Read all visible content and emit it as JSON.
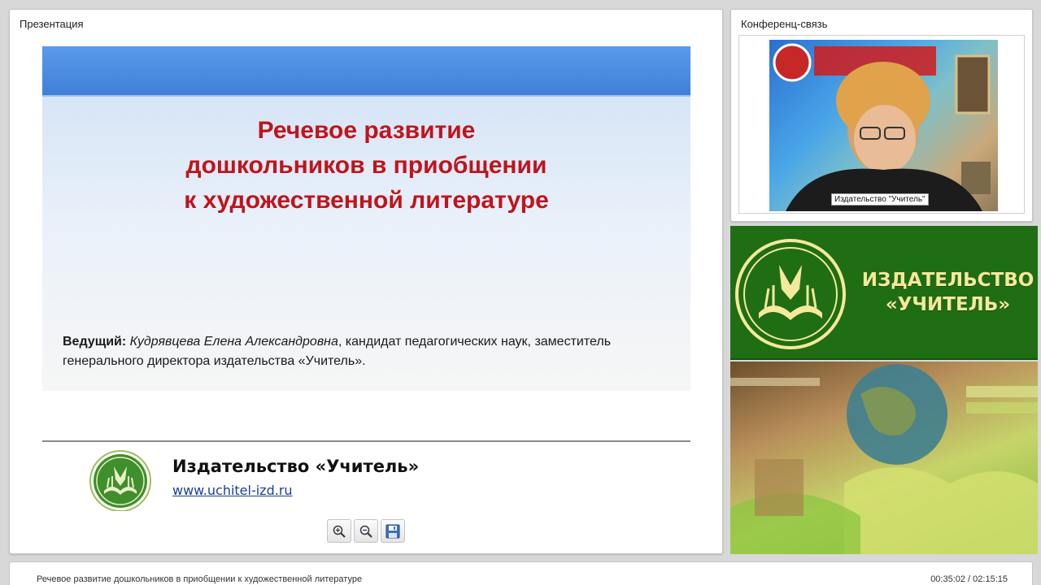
{
  "presentation": {
    "panel_title": "Презентация",
    "slide": {
      "title_line1": "Речевое развитие",
      "title_line2": "дошкольников в приобщении",
      "title_line3": "к художественной литературе",
      "presenter_label": "Ведущий:",
      "presenter_name": "Кудрявцева Елена Александровна",
      "presenter_desc": ", кандидат педагогических наук, заместитель генерального директора издательства «Учитель».",
      "publisher": "Издательство «Учитель»",
      "url": "www.uchitel-izd.ru",
      "title_color": "#c0141c"
    },
    "toolbar": [
      {
        "name": "zoom-in-icon"
      },
      {
        "name": "zoom-out-icon"
      },
      {
        "name": "save-icon"
      }
    ]
  },
  "conference": {
    "panel_title": "Конференц-связь",
    "video_caption": "Издательство \"Учитель\""
  },
  "banner": {
    "line1": "ИЗДАТЕЛЬСТВО",
    "line2": "«УЧИТЕЛЬ»",
    "bg_color": "#1f6e14",
    "text_color": "#f6e89c"
  },
  "footer": {
    "title": "Речевое развитие дошкольников в приобщении к художественной литературе",
    "time": "00:35:02 / 02:15:15"
  }
}
